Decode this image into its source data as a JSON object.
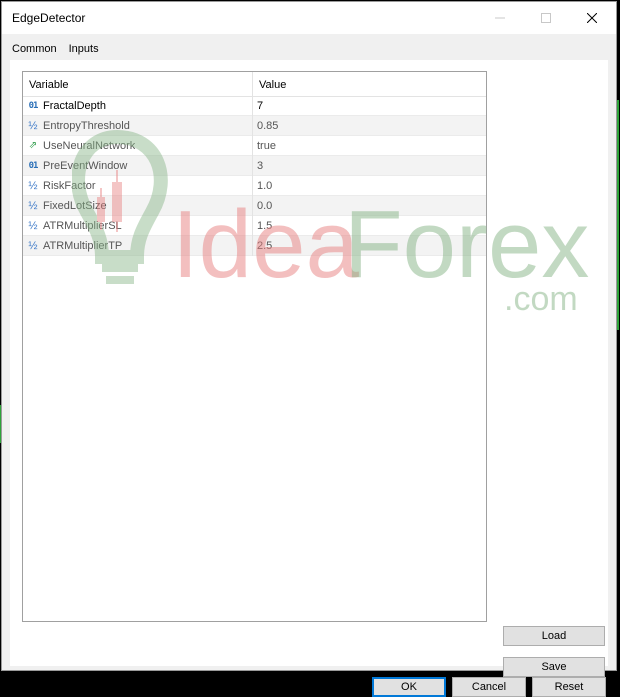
{
  "window": {
    "title": "EdgeDetector"
  },
  "tabs": [
    {
      "label": "Common",
      "active": false
    },
    {
      "label": "Inputs",
      "active": true
    }
  ],
  "grid": {
    "columns": {
      "variable": "Variable",
      "value": "Value"
    },
    "rows": [
      {
        "type_icon": "int-icon",
        "name": "FractalDepth",
        "value": "7"
      },
      {
        "type_icon": "double-icon",
        "name": "EntropyThreshold",
        "value": "0.85"
      },
      {
        "type_icon": "bool-icon",
        "name": "UseNeuralNetwork",
        "value": "true"
      },
      {
        "type_icon": "int-icon",
        "name": "PreEventWindow",
        "value": "3"
      },
      {
        "type_icon": "double-icon",
        "name": "RiskFactor",
        "value": "1.0"
      },
      {
        "type_icon": "double-icon",
        "name": "FixedLotSize",
        "value": "0.0"
      },
      {
        "type_icon": "double-icon",
        "name": "ATRMultiplierSL",
        "value": "1.5"
      },
      {
        "type_icon": "double-icon",
        "name": "ATRMultiplierTP",
        "value": "2.5"
      }
    ]
  },
  "icons": {
    "int": "01",
    "double": "½",
    "bool": "⇗"
  },
  "watermark": {
    "brand_left": "Idea",
    "brand_right": "Forex",
    "suffix": ".com"
  },
  "buttons": {
    "load": "Load",
    "save": "Save",
    "ok": "OK",
    "cancel": "Cancel",
    "reset": "Reset"
  },
  "colors": {
    "accent": "#0078d7",
    "tab_underline": "#0a64ad",
    "watermark_red": "#e88080",
    "watermark_green": "#86b486"
  }
}
